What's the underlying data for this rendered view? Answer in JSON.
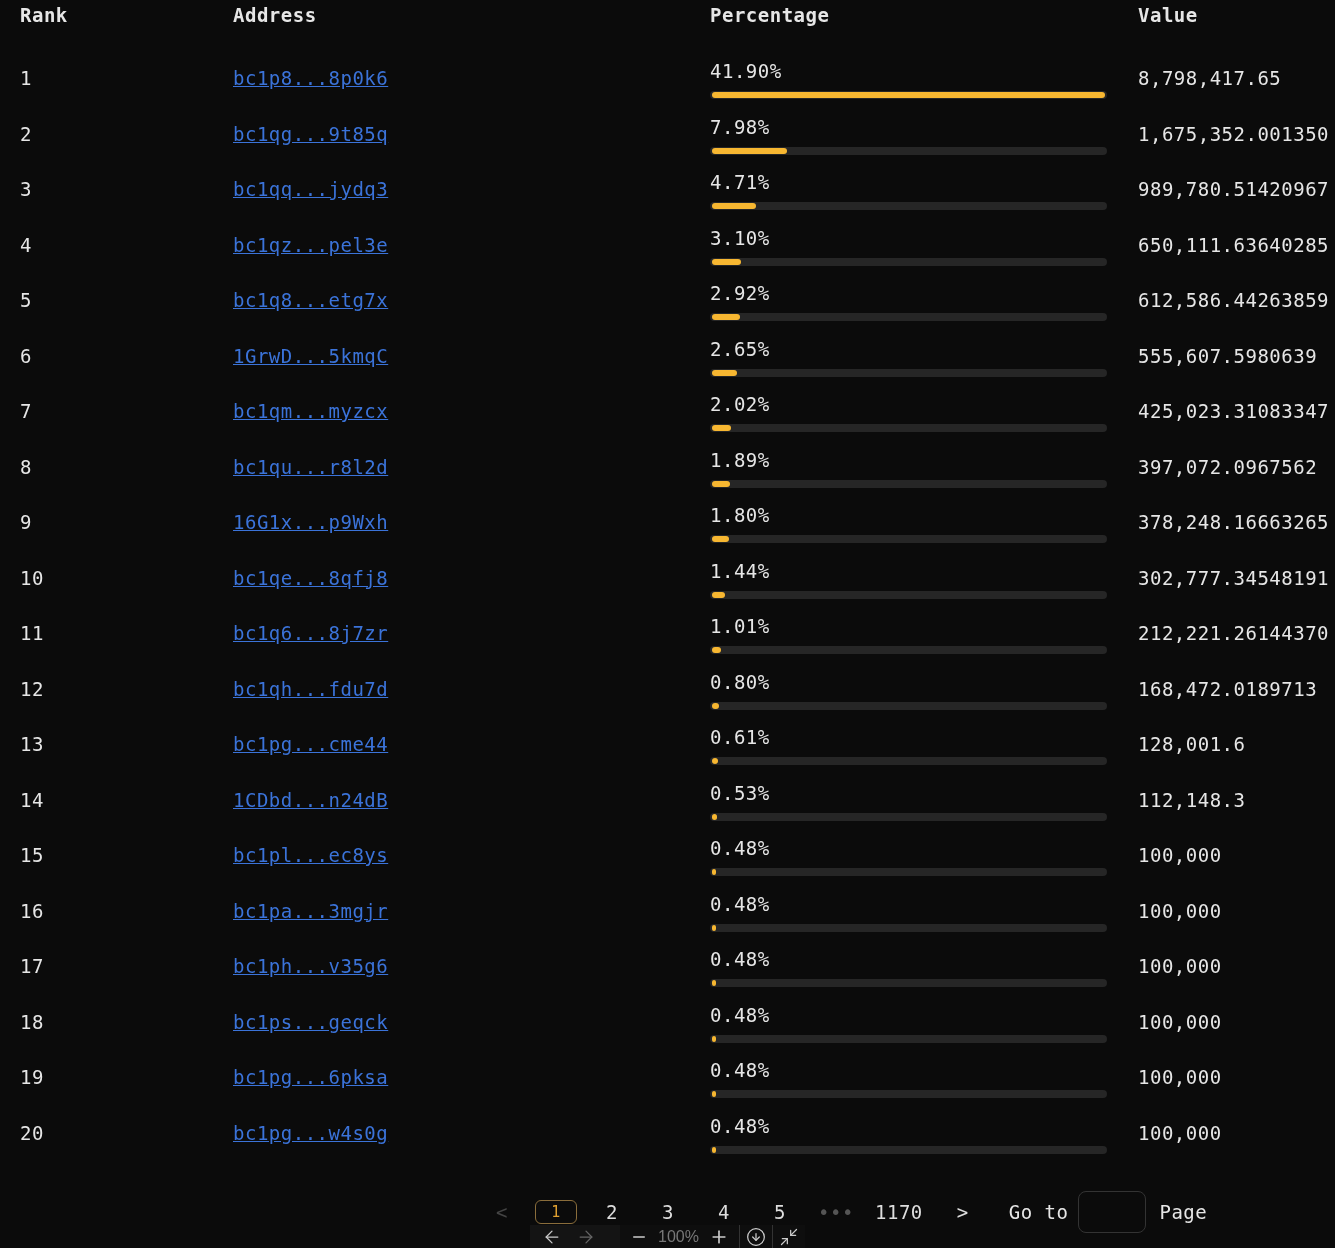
{
  "columns": [
    "Rank",
    "Address",
    "Percentage",
    "Value"
  ],
  "rows": [
    {
      "rank": "1",
      "address": "bc1p8...8p0k6",
      "percentage": "41.90%",
      "level": 1.0,
      "value": "8,798,417.65"
    },
    {
      "rank": "2",
      "address": "bc1qg...9t85q",
      "percentage": "7.98%",
      "level": 0.19,
      "value": "1,675,352.001350"
    },
    {
      "rank": "3",
      "address": "bc1qq...jydq3",
      "percentage": "4.71%",
      "level": 0.112,
      "value": "989,780.51420967"
    },
    {
      "rank": "4",
      "address": "bc1qz...pel3e",
      "percentage": "3.10%",
      "level": 0.074,
      "value": "650,111.63640285"
    },
    {
      "rank": "5",
      "address": "bc1q8...etg7x",
      "percentage": "2.92%",
      "level": 0.07,
      "value": "612,586.44263859"
    },
    {
      "rank": "6",
      "address": "1GrwD...5kmqC",
      "percentage": "2.65%",
      "level": 0.063,
      "value": "555,607.5980639"
    },
    {
      "rank": "7",
      "address": "bc1qm...myzcx",
      "percentage": "2.02%",
      "level": 0.048,
      "value": "425,023.31083347"
    },
    {
      "rank": "8",
      "address": "bc1qu...r8l2d",
      "percentage": "1.89%",
      "level": 0.045,
      "value": "397,072.0967562"
    },
    {
      "rank": "9",
      "address": "16G1x...p9Wxh",
      "percentage": "1.80%",
      "level": 0.043,
      "value": "378,248.16663265"
    },
    {
      "rank": "10",
      "address": "bc1qe...8qfj8",
      "percentage": "1.44%",
      "level": 0.034,
      "value": "302,777.34548191"
    },
    {
      "rank": "11",
      "address": "bc1q6...8j7zr",
      "percentage": "1.01%",
      "level": 0.024,
      "value": "212,221.26144370"
    },
    {
      "rank": "12",
      "address": "bc1qh...fdu7d",
      "percentage": "0.80%",
      "level": 0.019,
      "value": "168,472.0189713"
    },
    {
      "rank": "13",
      "address": "bc1pg...cme44",
      "percentage": "0.61%",
      "level": 0.015,
      "value": "128,001.6"
    },
    {
      "rank": "14",
      "address": "1CDbd...n24dB",
      "percentage": "0.53%",
      "level": 0.013,
      "value": "112,148.3"
    },
    {
      "rank": "15",
      "address": "bc1pl...ec8ys",
      "percentage": "0.48%",
      "level": 0.011,
      "value": "100,000"
    },
    {
      "rank": "16",
      "address": "bc1pa...3mgjr",
      "percentage": "0.48%",
      "level": 0.011,
      "value": "100,000"
    },
    {
      "rank": "17",
      "address": "bc1ph...v35g6",
      "percentage": "0.48%",
      "level": 0.011,
      "value": "100,000"
    },
    {
      "rank": "18",
      "address": "bc1ps...geqck",
      "percentage": "0.48%",
      "level": 0.011,
      "value": "100,000"
    },
    {
      "rank": "19",
      "address": "bc1pg...6pksa",
      "percentage": "0.48%",
      "level": 0.011,
      "value": "100,000"
    },
    {
      "rank": "20",
      "address": "bc1pg...w4s0g",
      "percentage": "0.48%",
      "level": 0.011,
      "value": "100,000"
    }
  ],
  "pagination": {
    "prev": {
      "label": "<",
      "disabled": true
    },
    "pages": [
      {
        "kind": "page",
        "label": "1",
        "selected": true
      },
      {
        "kind": "page",
        "label": "2",
        "selected": false
      },
      {
        "kind": "page",
        "label": "3",
        "selected": false
      },
      {
        "kind": "page",
        "label": "4",
        "selected": false
      },
      {
        "kind": "page",
        "label": "5",
        "selected": false
      },
      {
        "kind": "ellipsis",
        "label": "•••"
      },
      {
        "kind": "page",
        "label": "1170",
        "selected": false
      }
    ],
    "next": {
      "label": ">",
      "disabled": false
    },
    "goto_label": "Go to",
    "page_label": "Page"
  },
  "viewer_toolbar": {
    "zoom": "100%"
  }
}
